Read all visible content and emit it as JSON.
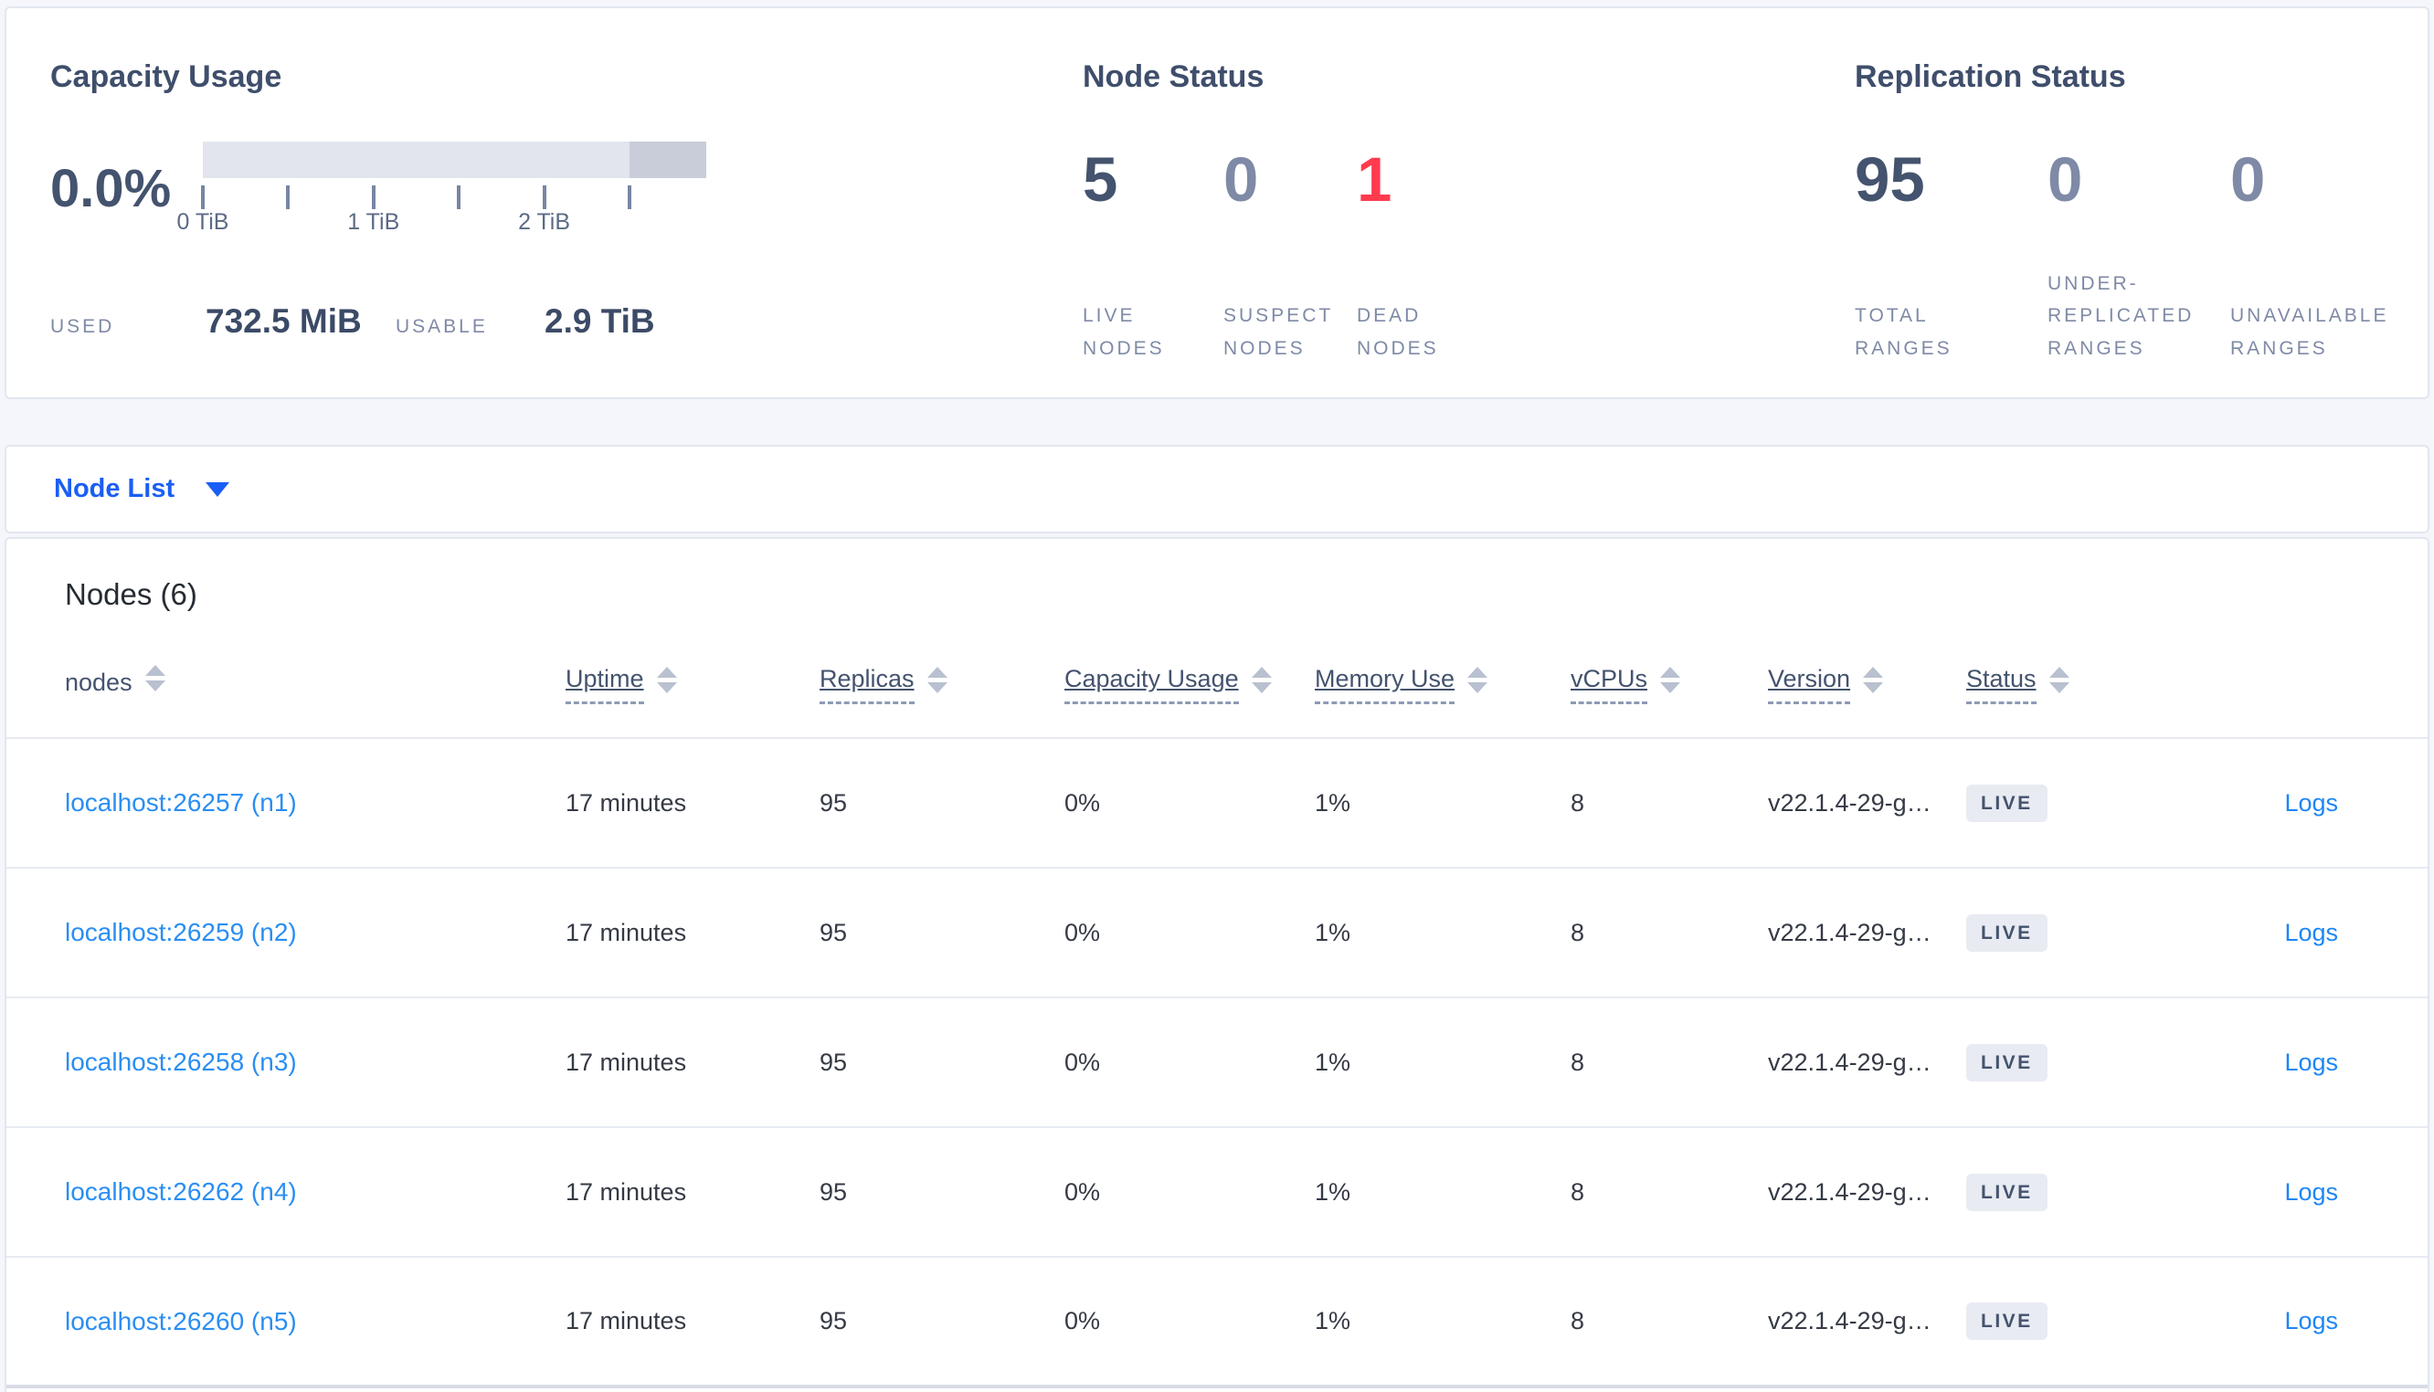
{
  "summary": {
    "capacity": {
      "title": "Capacity Usage",
      "percent": "0.0%",
      "used_label": "USED",
      "used_value": "732.5 MiB",
      "usable_label": "USABLE",
      "usable_value": "2.9 TiB",
      "tick_labels": [
        "0 TiB",
        "1 TiB",
        "2 TiB"
      ],
      "bar": {
        "light_segment_pct": 84.8,
        "dark_segment_pct": 15.2
      }
    },
    "node_status": {
      "title": "Node Status",
      "stats": [
        {
          "value": "5",
          "label": "LIVE\nNODES",
          "state": "dark"
        },
        {
          "value": "0",
          "label": "SUSPECT\nNODES",
          "state": "muted"
        },
        {
          "value": "1",
          "label": "DEAD\nNODES",
          "state": "red"
        }
      ]
    },
    "replication_status": {
      "title": "Replication Status",
      "stats": [
        {
          "value": "95",
          "label": "TOTAL\nRANGES",
          "state": "dark"
        },
        {
          "value": "0",
          "label": "UNDER-\nREPLICATED\nRANGES",
          "state": "muted"
        },
        {
          "value": "0",
          "label": "UNAVAILABLE\nRANGES",
          "state": "muted"
        }
      ]
    }
  },
  "view_selector": {
    "label": "Node List"
  },
  "nodes_section": {
    "title": "Nodes (6)",
    "columns": {
      "nodes": "nodes",
      "uptime": "Uptime",
      "replicas": "Replicas",
      "capacity": "Capacity Usage",
      "memory": "Memory Use",
      "vcpus": "vCPUs",
      "version": "Version",
      "status": "Status"
    },
    "rows": [
      {
        "node": "localhost:26257 (n1)",
        "uptime": "17 minutes",
        "replicas": "95",
        "capacity": "0%",
        "memory": "1%",
        "vcpus": "8",
        "version": "v22.1.4-29-g…",
        "status": "LIVE",
        "logs": "Logs"
      },
      {
        "node": "localhost:26259 (n2)",
        "uptime": "17 minutes",
        "replicas": "95",
        "capacity": "0%",
        "memory": "1%",
        "vcpus": "8",
        "version": "v22.1.4-29-g…",
        "status": "LIVE",
        "logs": "Logs"
      },
      {
        "node": "localhost:26258 (n3)",
        "uptime": "17 minutes",
        "replicas": "95",
        "capacity": "0%",
        "memory": "1%",
        "vcpus": "8",
        "version": "v22.1.4-29-g…",
        "status": "LIVE",
        "logs": "Logs"
      },
      {
        "node": "localhost:26262 (n4)",
        "uptime": "17 minutes",
        "replicas": "95",
        "capacity": "0%",
        "memory": "1%",
        "vcpus": "8",
        "version": "v22.1.4-29-g…",
        "status": "LIVE",
        "logs": "Logs"
      },
      {
        "node": "localhost:26260 (n5)",
        "uptime": "17 minutes",
        "replicas": "95",
        "capacity": "0%",
        "memory": "1%",
        "vcpus": "8",
        "version": "v22.1.4-29-g…",
        "status": "LIVE",
        "logs": "Logs"
      }
    ]
  },
  "colors": {
    "accent_blue": "#1a5ef5",
    "link_blue": "#2a8ef2",
    "dead_red": "#ff3b4e",
    "dark_slate": "#44536e",
    "muted_slate": "#7e8aa6",
    "bar_light": "#e2e4ee",
    "bar_dark": "#c9cdd9",
    "badge_bg": "#e8ebf2"
  }
}
